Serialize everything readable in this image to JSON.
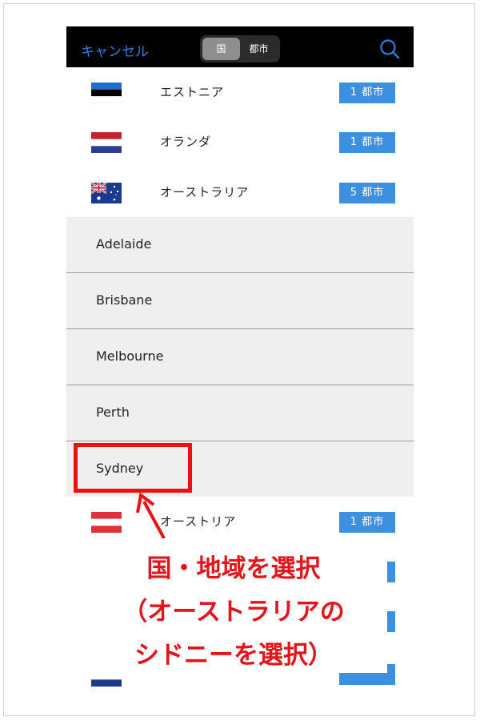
{
  "navbar": {
    "cancel_label": "キャンセル",
    "segments": [
      "国",
      "都市"
    ],
    "selected_segment": "国",
    "search_icon": "search-icon"
  },
  "countries_top": [
    {
      "name": "エストニア",
      "badge": "1 都市",
      "flag": "estonia-flag"
    },
    {
      "name": "オランダ",
      "badge": "1 都市",
      "flag": "netherlands-flag"
    },
    {
      "name": "オーストラリア",
      "badge": "5 都市",
      "flag": "australia-flag"
    }
  ],
  "cities": [
    "Adelaide",
    "Brisbane",
    "Melbourne",
    "Perth",
    "Sydney"
  ],
  "countries_bottom": [
    {
      "name": "オーストリア",
      "badge": "1 都市",
      "flag": "austria-flag"
    }
  ],
  "annotation": {
    "lines": [
      "国・地域を選択",
      "（オーストラリアの",
      "シドニーを選択）"
    ],
    "highlighted_city": "Sydney"
  },
  "colors": {
    "navbar_bg": "#000000",
    "accent_blue": "#2f7de1",
    "badge_blue": "#3d8fe0",
    "annotation_red": "#e3141a"
  }
}
